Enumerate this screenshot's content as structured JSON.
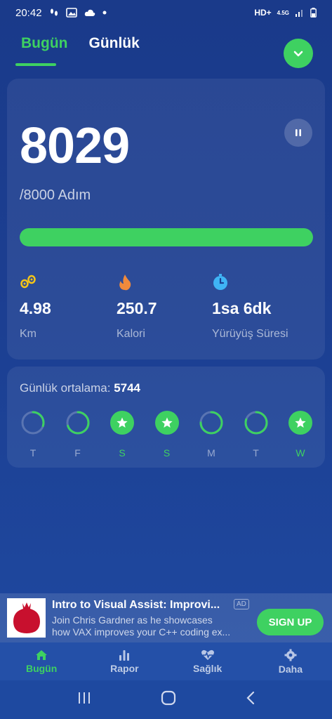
{
  "status_bar": {
    "time": "20:42",
    "network": "HD+",
    "network_type": "4.5G"
  },
  "tabs": [
    {
      "label": "Bugün",
      "active": true
    },
    {
      "label": "Günlük",
      "active": false
    }
  ],
  "main_card": {
    "steps": "8029",
    "goal": "/8000 Adım",
    "progress": 1.0,
    "stats": [
      {
        "icon": "footsteps-icon",
        "value": "4.98",
        "label": "Km"
      },
      {
        "icon": "flame-icon",
        "value": "250.7",
        "label": "Kalori"
      },
      {
        "icon": "timer-icon",
        "value": "1sa 6dk",
        "label": "Yürüyüş Süresi"
      }
    ]
  },
  "daily": {
    "avg_label": "Günlük ortalama:",
    "avg_value": "5744",
    "days": [
      {
        "label": "T",
        "status": "partial",
        "fraction": 0.3
      },
      {
        "label": "F",
        "status": "partial",
        "fraction": 0.7
      },
      {
        "label": "S",
        "status": "done"
      },
      {
        "label": "S",
        "status": "done"
      },
      {
        "label": "M",
        "status": "partial",
        "fraction": 0.75
      },
      {
        "label": "T",
        "status": "partial",
        "fraction": 0.8
      },
      {
        "label": "W",
        "status": "done"
      }
    ]
  },
  "ad": {
    "title": "Intro to Visual Assist: Improvi...",
    "badge": "AD",
    "body_line1": "Join Chris Gardner as he showcases",
    "body_line2": "how VAX improves your C++ coding ex...",
    "cta": "SIGN UP"
  },
  "bottom_nav": [
    {
      "label": "Bugün",
      "icon": "home-icon",
      "active": true
    },
    {
      "label": "Rapor",
      "icon": "bar-chart-icon",
      "active": false
    },
    {
      "label": "Sağlık",
      "icon": "heart-pulse-icon",
      "active": false
    },
    {
      "label": "Daha",
      "icon": "gear-icon",
      "active": false
    }
  ],
  "colors": {
    "accent": "#3ed161",
    "background": "#1c3f92",
    "flame": "#f08a3c",
    "footsteps": "#f5c518",
    "timer": "#3fb4f5"
  }
}
